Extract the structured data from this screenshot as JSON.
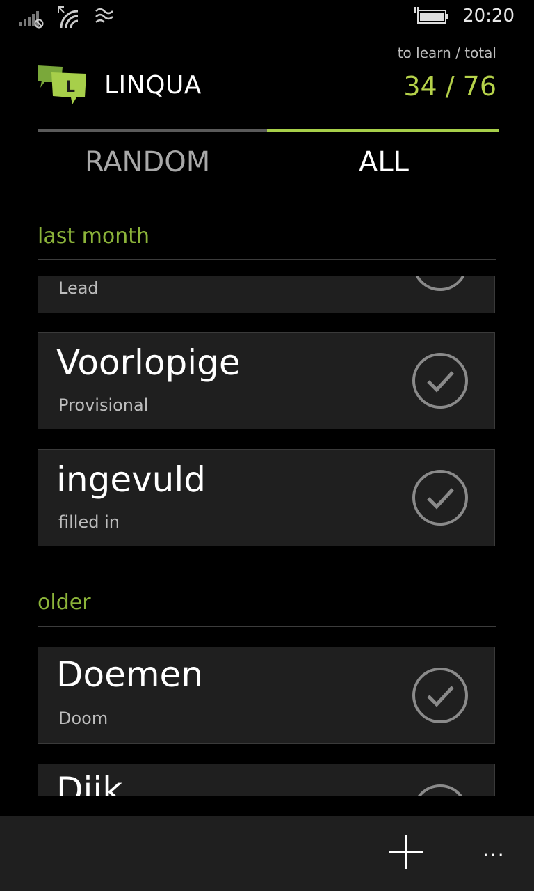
{
  "status_bar": {
    "time": "20:20",
    "icons": [
      "signal-icon",
      "data-transfer-icon",
      "wifi-icon",
      "battery-charging-icon"
    ]
  },
  "header": {
    "app_name": "LINQUA",
    "logo_letter": "L",
    "counter_label": "to learn / total",
    "counter_value": "34 / 76",
    "accent_color": "#a7cf4a"
  },
  "tabs": [
    {
      "label": "RANDOM",
      "active": false
    },
    {
      "label": "ALL",
      "active": true
    }
  ],
  "groups": [
    {
      "header": "last month",
      "items": [
        {
          "word": "",
          "translation": "Lead",
          "learned": true
        },
        {
          "word": "Voorlopige",
          "translation": "Provisional",
          "learned": true
        },
        {
          "word": "ingevuld",
          "translation": "filled in",
          "learned": true
        }
      ]
    },
    {
      "header": "older",
      "items": [
        {
          "word": "Doemen",
          "translation": "Doom",
          "learned": true
        },
        {
          "word": "Dijk",
          "translation": "",
          "learned": true
        }
      ]
    }
  ],
  "app_bar": {
    "add_icon": "plus-icon",
    "more_label": "···"
  }
}
